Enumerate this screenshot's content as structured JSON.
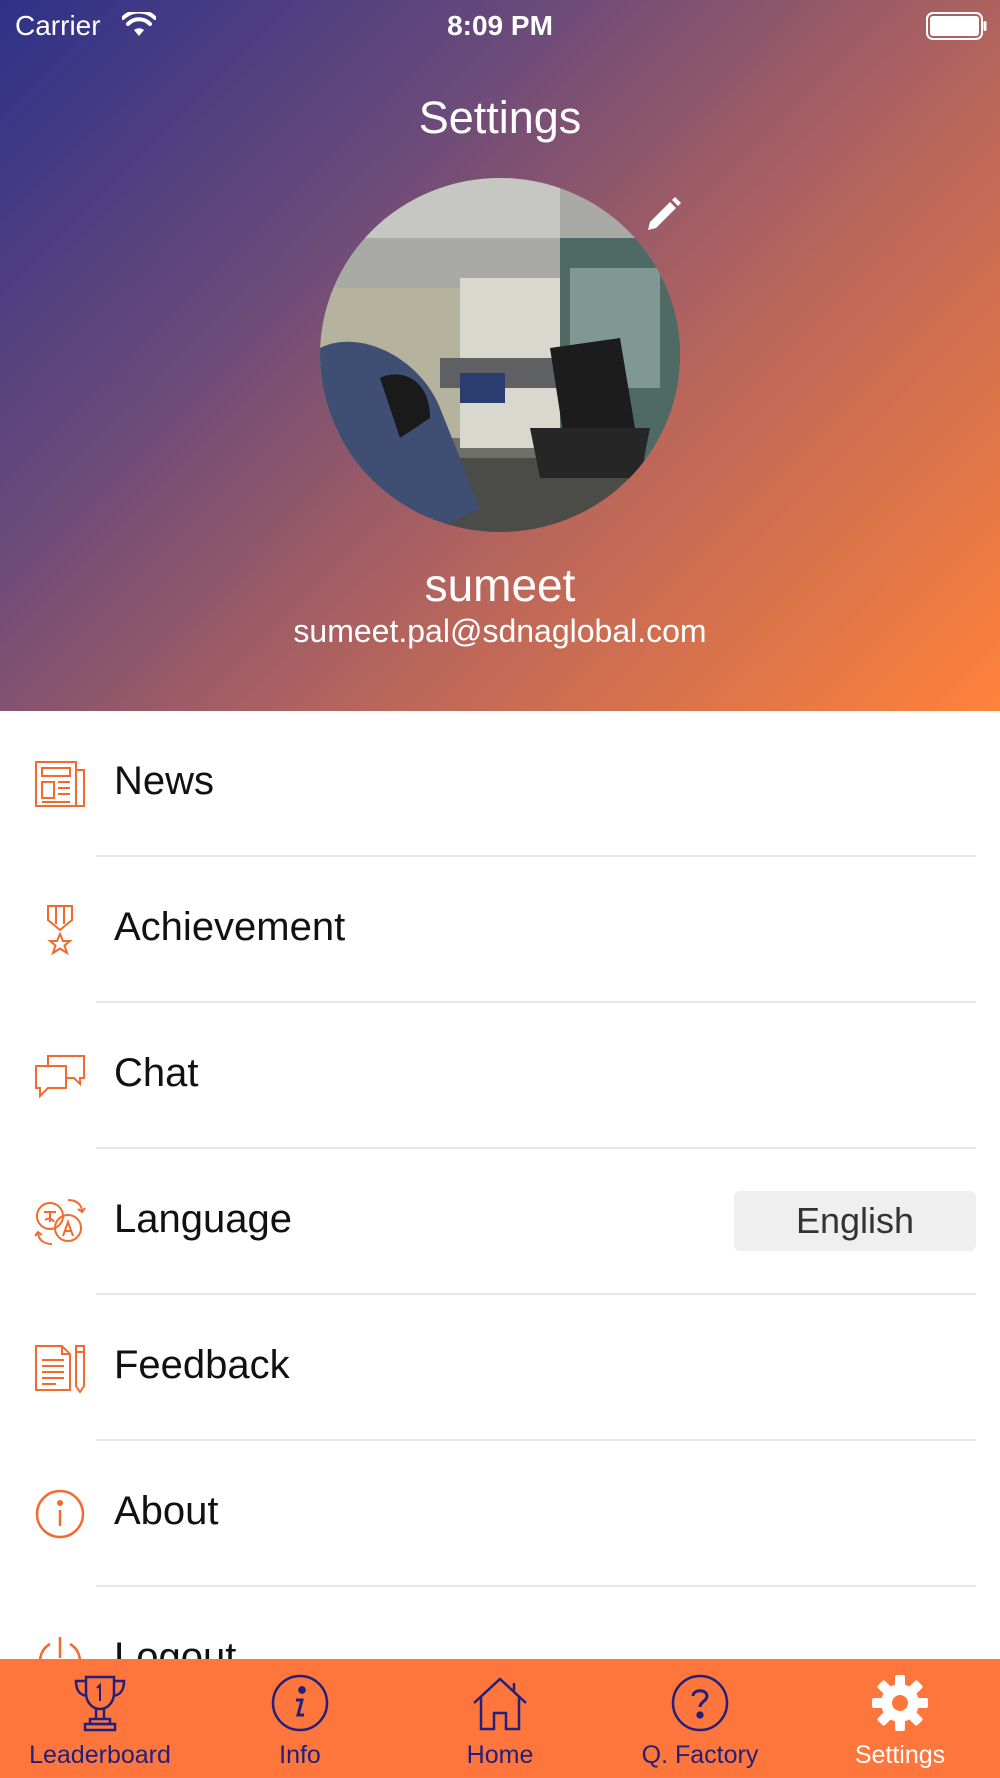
{
  "status_bar": {
    "carrier": "Carrier",
    "time": "8:09 PM"
  },
  "header": {
    "title": "Settings",
    "username": "sumeet",
    "email": "sumeet.pal@sdnaglobal.com"
  },
  "menu": {
    "items": [
      {
        "label": "News",
        "icon": "newspaper-icon"
      },
      {
        "label": "Achievement",
        "icon": "medal-icon"
      },
      {
        "label": "Chat",
        "icon": "chat-bubbles-icon"
      },
      {
        "label": "Language",
        "icon": "translate-icon",
        "value": "English"
      },
      {
        "label": "Feedback",
        "icon": "document-pen-icon"
      },
      {
        "label": "About",
        "icon": "info-circle-icon"
      },
      {
        "label": "Logout",
        "icon": "power-icon"
      }
    ]
  },
  "tabbar": {
    "tabs": [
      {
        "label": "Leaderboard",
        "icon": "trophy-icon"
      },
      {
        "label": "Info",
        "icon": "info-icon"
      },
      {
        "label": "Home",
        "icon": "home-icon"
      },
      {
        "label": "Q. Factory",
        "icon": "question-icon"
      },
      {
        "label": "Settings",
        "icon": "gear-icon",
        "active": true
      }
    ]
  },
  "colors": {
    "accent": "#ff763c",
    "tab_inactive": "#22207a",
    "icon_orange": "#f26a2e"
  }
}
